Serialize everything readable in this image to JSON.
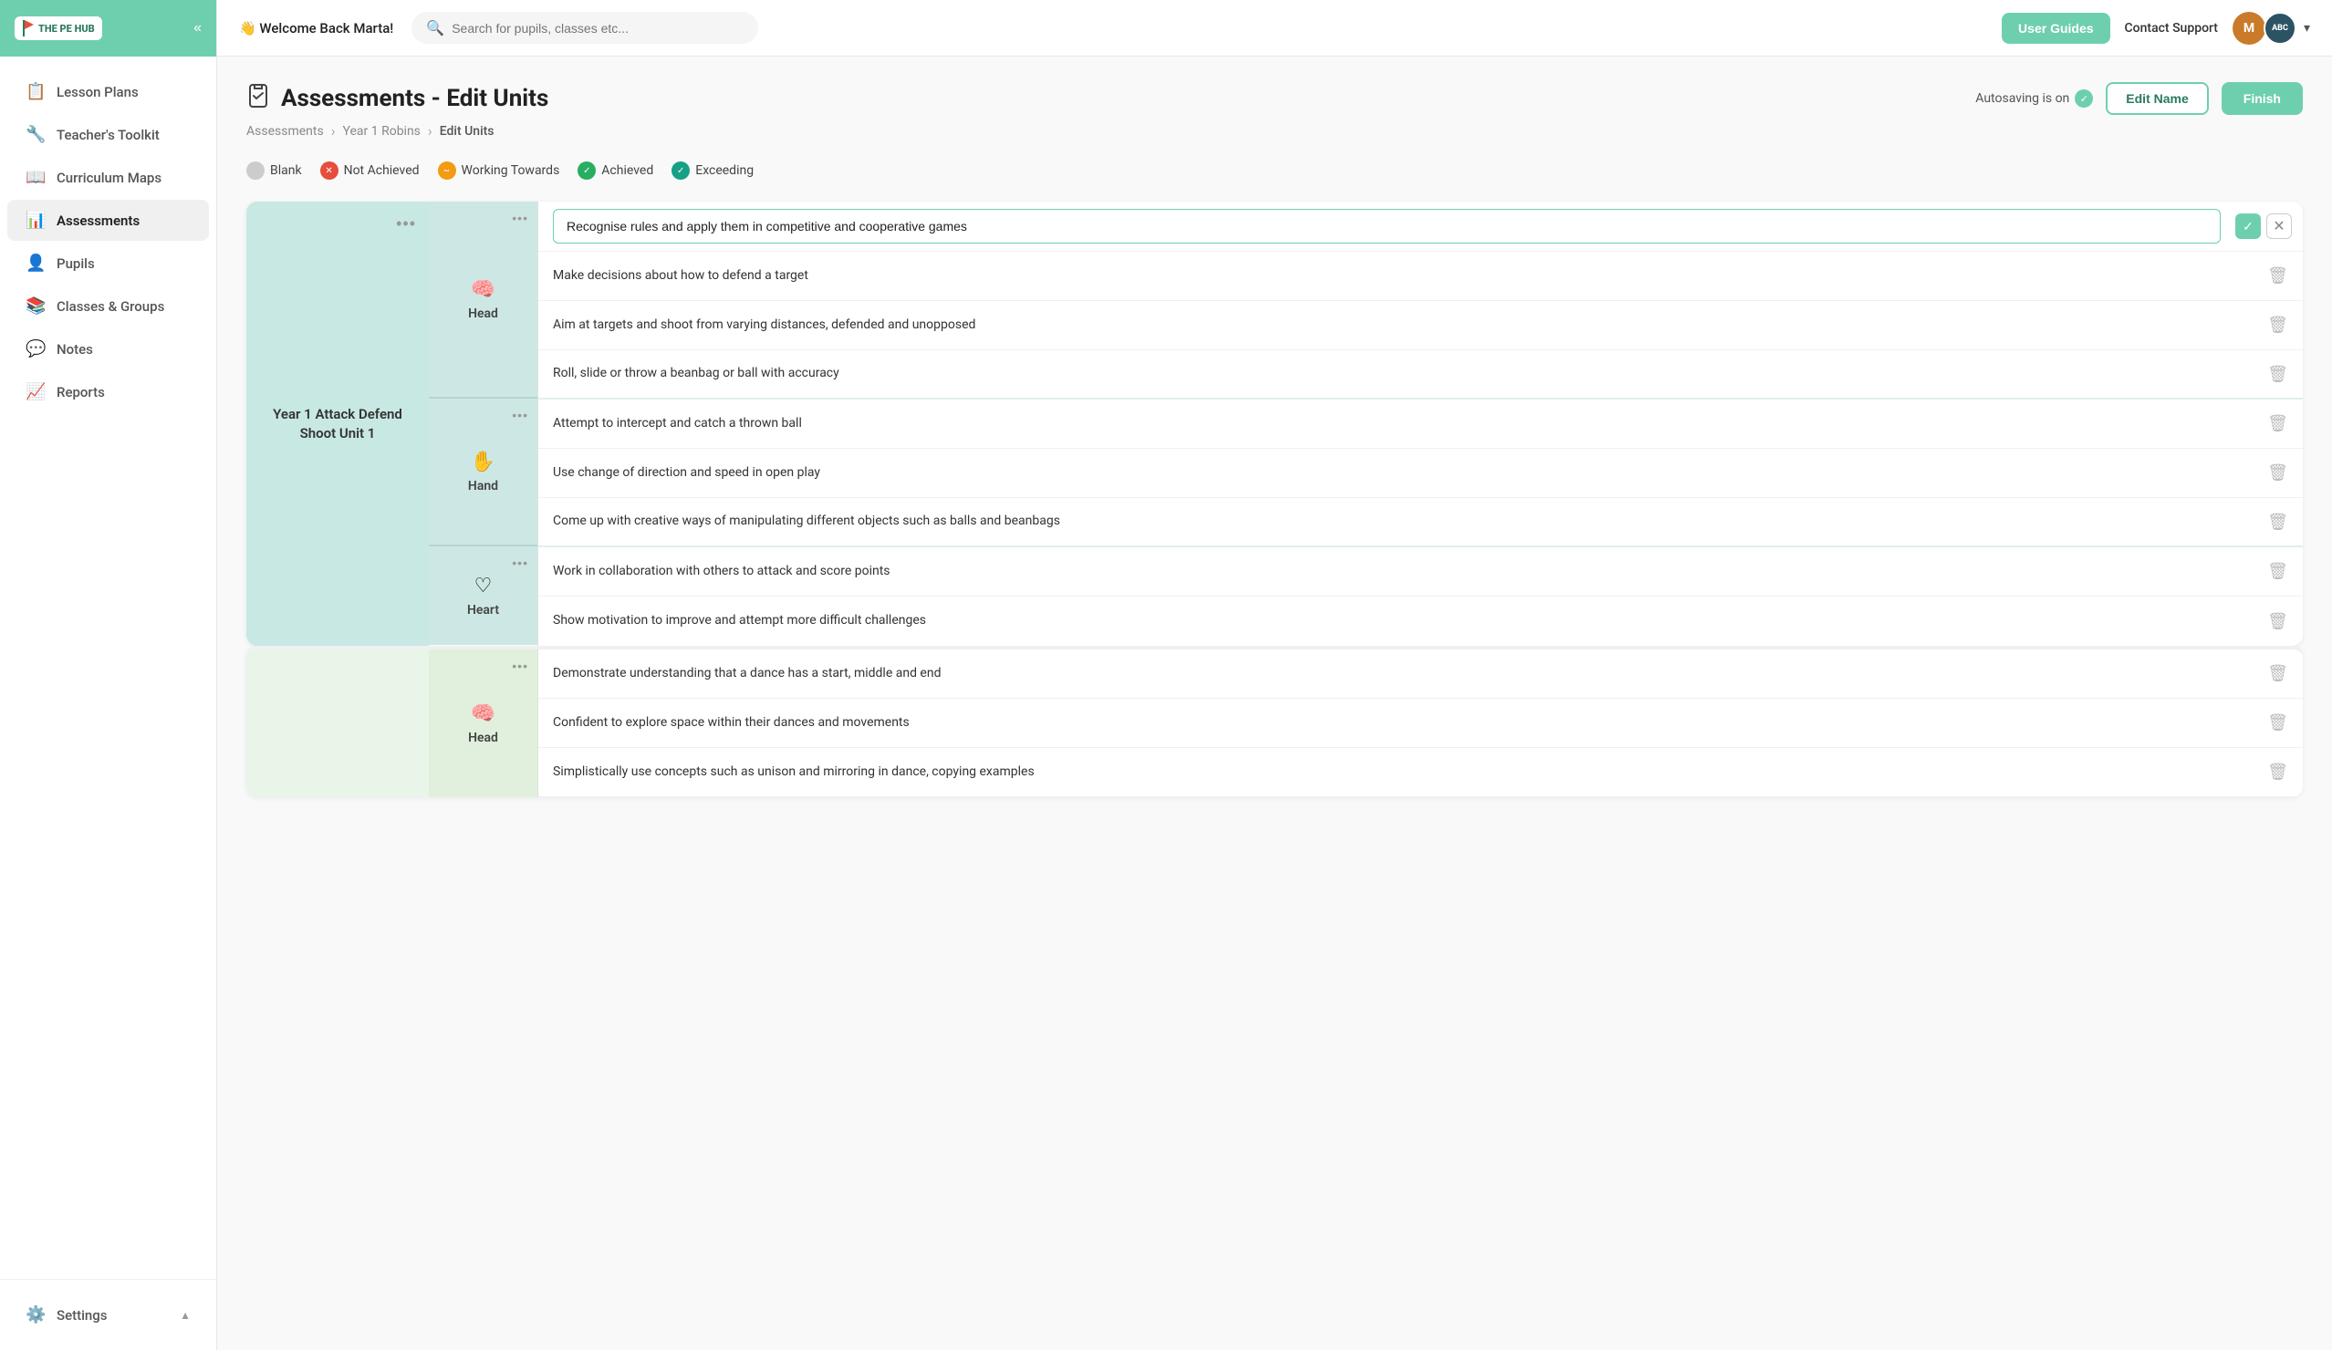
{
  "sidebar": {
    "logo_text": "THE PE HUB",
    "nav_items": [
      {
        "id": "lesson-plans",
        "label": "Lesson Plans",
        "icon": "📋"
      },
      {
        "id": "teachers-toolkit",
        "label": "Teacher's Toolkit",
        "icon": "🔧"
      },
      {
        "id": "curriculum-maps",
        "label": "Curriculum Maps",
        "icon": "📖"
      },
      {
        "id": "assessments",
        "label": "Assessments",
        "icon": "📊",
        "active": true
      },
      {
        "id": "pupils",
        "label": "Pupils",
        "icon": "👤"
      },
      {
        "id": "classes-groups",
        "label": "Classes & Groups",
        "icon": "📚"
      },
      {
        "id": "notes",
        "label": "Notes",
        "icon": "💬"
      },
      {
        "id": "reports",
        "label": "Reports",
        "icon": "📈"
      }
    ],
    "bottom_items": [
      {
        "id": "settings",
        "label": "Settings",
        "icon": "⚙️"
      }
    ]
  },
  "topbar": {
    "welcome_message": "👋 Welcome Back Marta!",
    "search_placeholder": "Search for pupils, classes etc...",
    "user_guides_label": "User Guides",
    "contact_support_label": "Contact Support",
    "user_initials": "M",
    "school_badge": "ABC"
  },
  "page": {
    "title": "Assessments - Edit Units",
    "autosave_label": "Autosaving is on",
    "edit_name_label": "Edit Name",
    "finish_label": "Finish",
    "breadcrumb": {
      "root": "Assessments",
      "level2": "Year 1 Robins",
      "current": "Edit Units"
    }
  },
  "legend": {
    "items": [
      {
        "id": "blank",
        "label": "Blank",
        "color": "#ccc"
      },
      {
        "id": "not-achieved",
        "label": "Not Achieved",
        "color": "#e74c3c"
      },
      {
        "id": "working-towards",
        "label": "Working Towards",
        "color": "#f39c12"
      },
      {
        "id": "achieved",
        "label": "Achieved",
        "color": "#27ae60"
      },
      {
        "id": "exceeding",
        "label": "Exceeding",
        "color": "#16a085"
      }
    ]
  },
  "assessment": {
    "unit_name": "Year 1 Attack Defend Shoot Unit 1",
    "sections": [
      {
        "id": "head",
        "label": "Head",
        "icon": "🧠",
        "criteria": [
          {
            "id": 1,
            "text": "Recognise rules and apply them in competitive and cooperative games",
            "editing": true
          },
          {
            "id": 2,
            "text": "Make decisions about how to defend a target",
            "editing": false
          },
          {
            "id": 3,
            "text": "Aim at targets and shoot from varying distances, defended and unopposed",
            "editing": false
          },
          {
            "id": 4,
            "text": "Roll, slide or throw a beanbag or ball with accuracy",
            "editing": false
          }
        ]
      },
      {
        "id": "hand",
        "label": "Hand",
        "icon": "✋",
        "criteria": [
          {
            "id": 5,
            "text": "Attempt to intercept and catch a thrown ball",
            "editing": false
          },
          {
            "id": 6,
            "text": "Use change of direction and speed in open play",
            "editing": false
          },
          {
            "id": 7,
            "text": "Come up with creative ways of manipulating different objects such as balls and beanbags",
            "editing": false
          }
        ]
      },
      {
        "id": "heart",
        "label": "Heart",
        "icon": "♡",
        "criteria": [
          {
            "id": 8,
            "text": "Work in collaboration with others to attack and score points",
            "editing": false
          },
          {
            "id": 9,
            "text": "Show motivation to improve and attempt more difficult challenges",
            "editing": false
          }
        ]
      }
    ],
    "unit2_sections": [
      {
        "id": "head2",
        "label": "Head",
        "icon": "🧠",
        "criteria": [
          {
            "id": 10,
            "text": "Demonstrate understanding that a dance has a start, middle and end",
            "editing": false
          },
          {
            "id": 11,
            "text": "Confident to explore space within their dances and movements",
            "editing": false
          },
          {
            "id": 12,
            "text": "Simplistically use concepts such as unison and mirroring in dance, copying examples",
            "editing": false
          }
        ]
      }
    ]
  }
}
